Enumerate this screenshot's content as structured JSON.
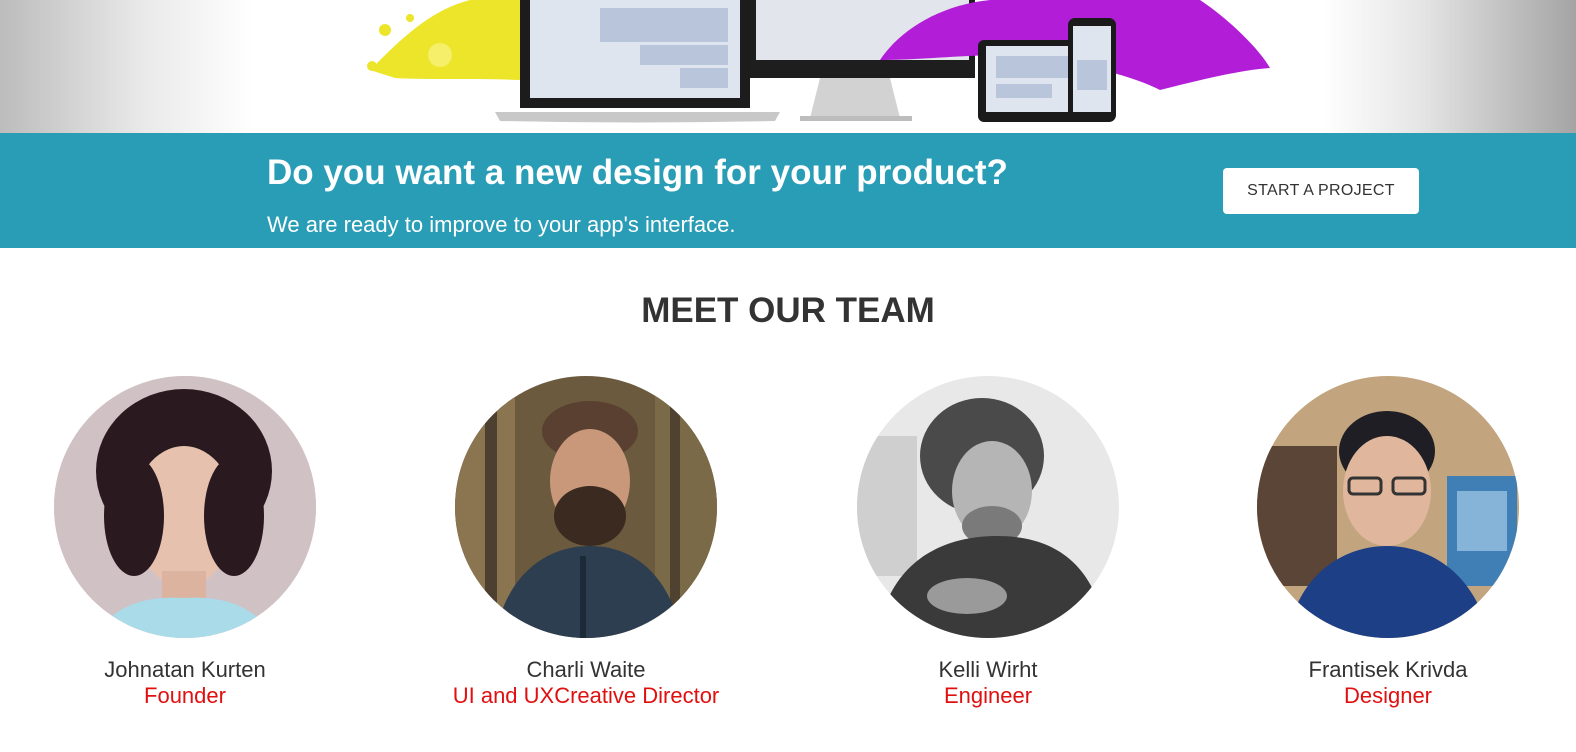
{
  "cta": {
    "title": "Do you want a new design for your product?",
    "subtitle": "We are ready to improve to your app's interface.",
    "button_label": "START A PROJECT"
  },
  "team": {
    "heading": "MEET OUR TEAM",
    "members": [
      {
        "name": "Johnatan Kurten",
        "role": "Founder"
      },
      {
        "name": "Charli Waite",
        "role": "UI and UXCreative Director"
      },
      {
        "name": "Kelli Wirht",
        "role": "Engineer"
      },
      {
        "name": "Frantisek Krivda",
        "role": "Designer"
      }
    ]
  },
  "colors": {
    "cta_band": "#2a9db6",
    "role_text": "#e11010",
    "heading_text": "#333333"
  }
}
